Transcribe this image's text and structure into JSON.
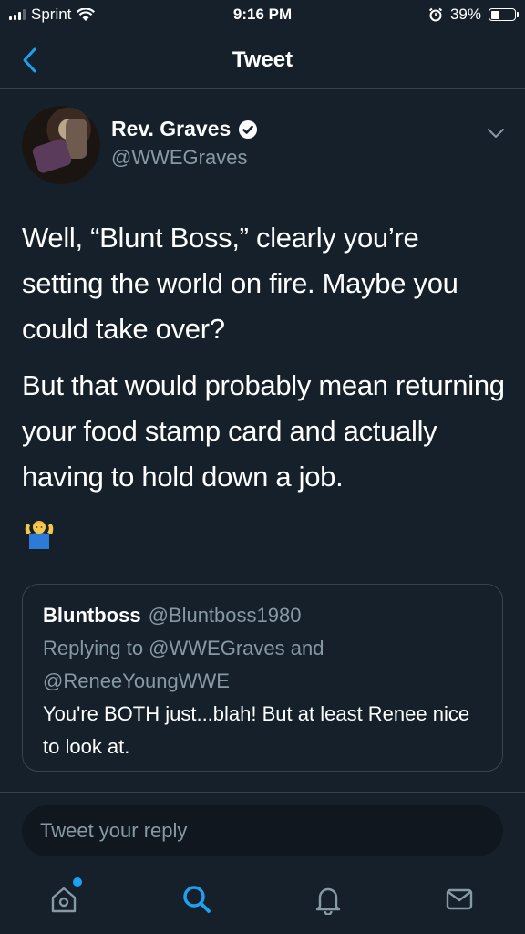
{
  "status_bar": {
    "carrier": "Sprint",
    "time": "9:16 PM",
    "battery": "39%",
    "battery_level": 0.39
  },
  "nav": {
    "title": "Tweet"
  },
  "tweet": {
    "author_name": "Rev. Graves",
    "author_handle": "@WWEGraves",
    "paragraphs": [
      "Well, “Blunt Boss,” clearly you’re setting the world on fire. Maybe you could take over?",
      "But that would probably mean returning your food stamp card and actually having to hold down a job."
    ],
    "emoji": "man-shrugging"
  },
  "quoted": {
    "name": "Bluntboss",
    "handle": "@Bluntboss1980",
    "replying_to": "Replying to @WWEGraves and @ReneeYoungWWE",
    "text": "You're BOTH just...blah! But at least Renee nice to look at."
  },
  "reply": {
    "placeholder": "Tweet your reply"
  },
  "tabs": {
    "home_icon": "home-icon",
    "search_icon": "search-icon",
    "notifications_icon": "bell-icon",
    "messages_icon": "mail-icon"
  },
  "colors": {
    "background": "#15202b",
    "accent": "#1da1f2",
    "secondary_text": "#8899a6"
  }
}
